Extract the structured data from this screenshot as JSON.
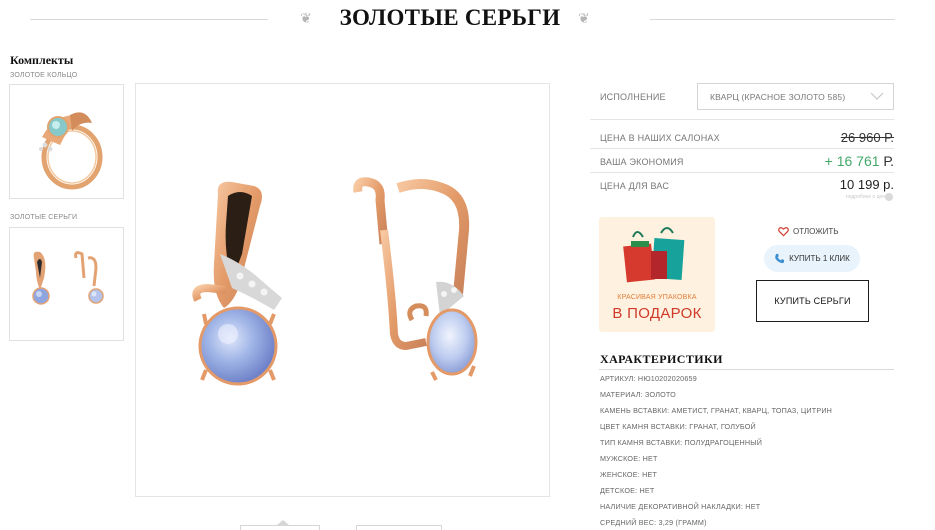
{
  "header": {
    "title": "ЗОЛОТЫЕ СЕРЬГИ",
    "flourish_left": "❦",
    "flourish_right": "❦"
  },
  "sets": {
    "title": "Комплекты",
    "items": [
      {
        "label": "ЗОЛОТОЕ КОЛЬЦО",
        "icon": "ring-thumbnail"
      },
      {
        "label": "ЗОЛОТЫЕ СЕРЬГИ",
        "icon": "earrings-thumbnail"
      }
    ]
  },
  "product": {
    "main_image": "earrings-product-image",
    "option": {
      "label": "ИСПОЛНЕНИЕ",
      "value": "КВАРЦ (КРАСНОЕ ЗОЛОТО 585)"
    },
    "prices": {
      "old_label": "ЦЕНА В НАШИХ САЛОНАХ",
      "old_value": "26 960 Р.",
      "economy_label": "ВАША ЭКОНОМИЯ",
      "economy_value": "+ 16 761",
      "economy_currency": "Р.",
      "final_label": "ЦЕНА ДЛЯ ВАС",
      "final_value": "10 199 р.",
      "note": "подробнее о цене"
    },
    "gift": {
      "line1": "КРАСИВАЯ УПАКОВКА",
      "line2": "В ПОДАРОК"
    },
    "actions": {
      "wishlist": "ОТЛОЖИТЬ",
      "one_click": "КУПИТЬ 1 КЛИК",
      "buy": "КУПИТЬ СЕРЬГИ"
    }
  },
  "characteristics": {
    "title": "ХАРАКТЕРИСТИКИ",
    "items": [
      "АРТИКУЛ: НЮ10202020659",
      "МАТЕРИАЛ: ЗОЛОТО",
      "КАМЕНЬ ВСТАВКИ: АМЕТИСТ, ГРАНАТ, КВАРЦ, ТОПАЗ, ЦИТРИН",
      "ЦВЕТ КАМНЯ ВСТАВКИ: ГРАНАТ, ГОЛУБОЙ",
      "ТИП КАМНЯ ВСТАВКИ: ПОЛУДРАГОЦЕННЫЙ",
      "МУЖСКОЕ: НЕТ",
      "ЖЕНСКОЕ: НЕТ",
      "ДЕТСКОЕ: НЕТ",
      "НАЛИЧИЕ ДЕКОРАТИВНОЙ НАКЛАДКИ: НЕТ",
      "СРЕДНИЙ ВЕС: 3,29 (ГРАММ)"
    ]
  },
  "colors": {
    "gold": "#e8a877",
    "gold_dark": "#c9825a",
    "stone": "#9fb4e6",
    "economy_green": "#42a86a",
    "gift_red": "#d03a2b",
    "gift_orange": "#e27f3b",
    "gift_bg": "#fef1df",
    "oneclick_bg": "#e8f3fb"
  }
}
